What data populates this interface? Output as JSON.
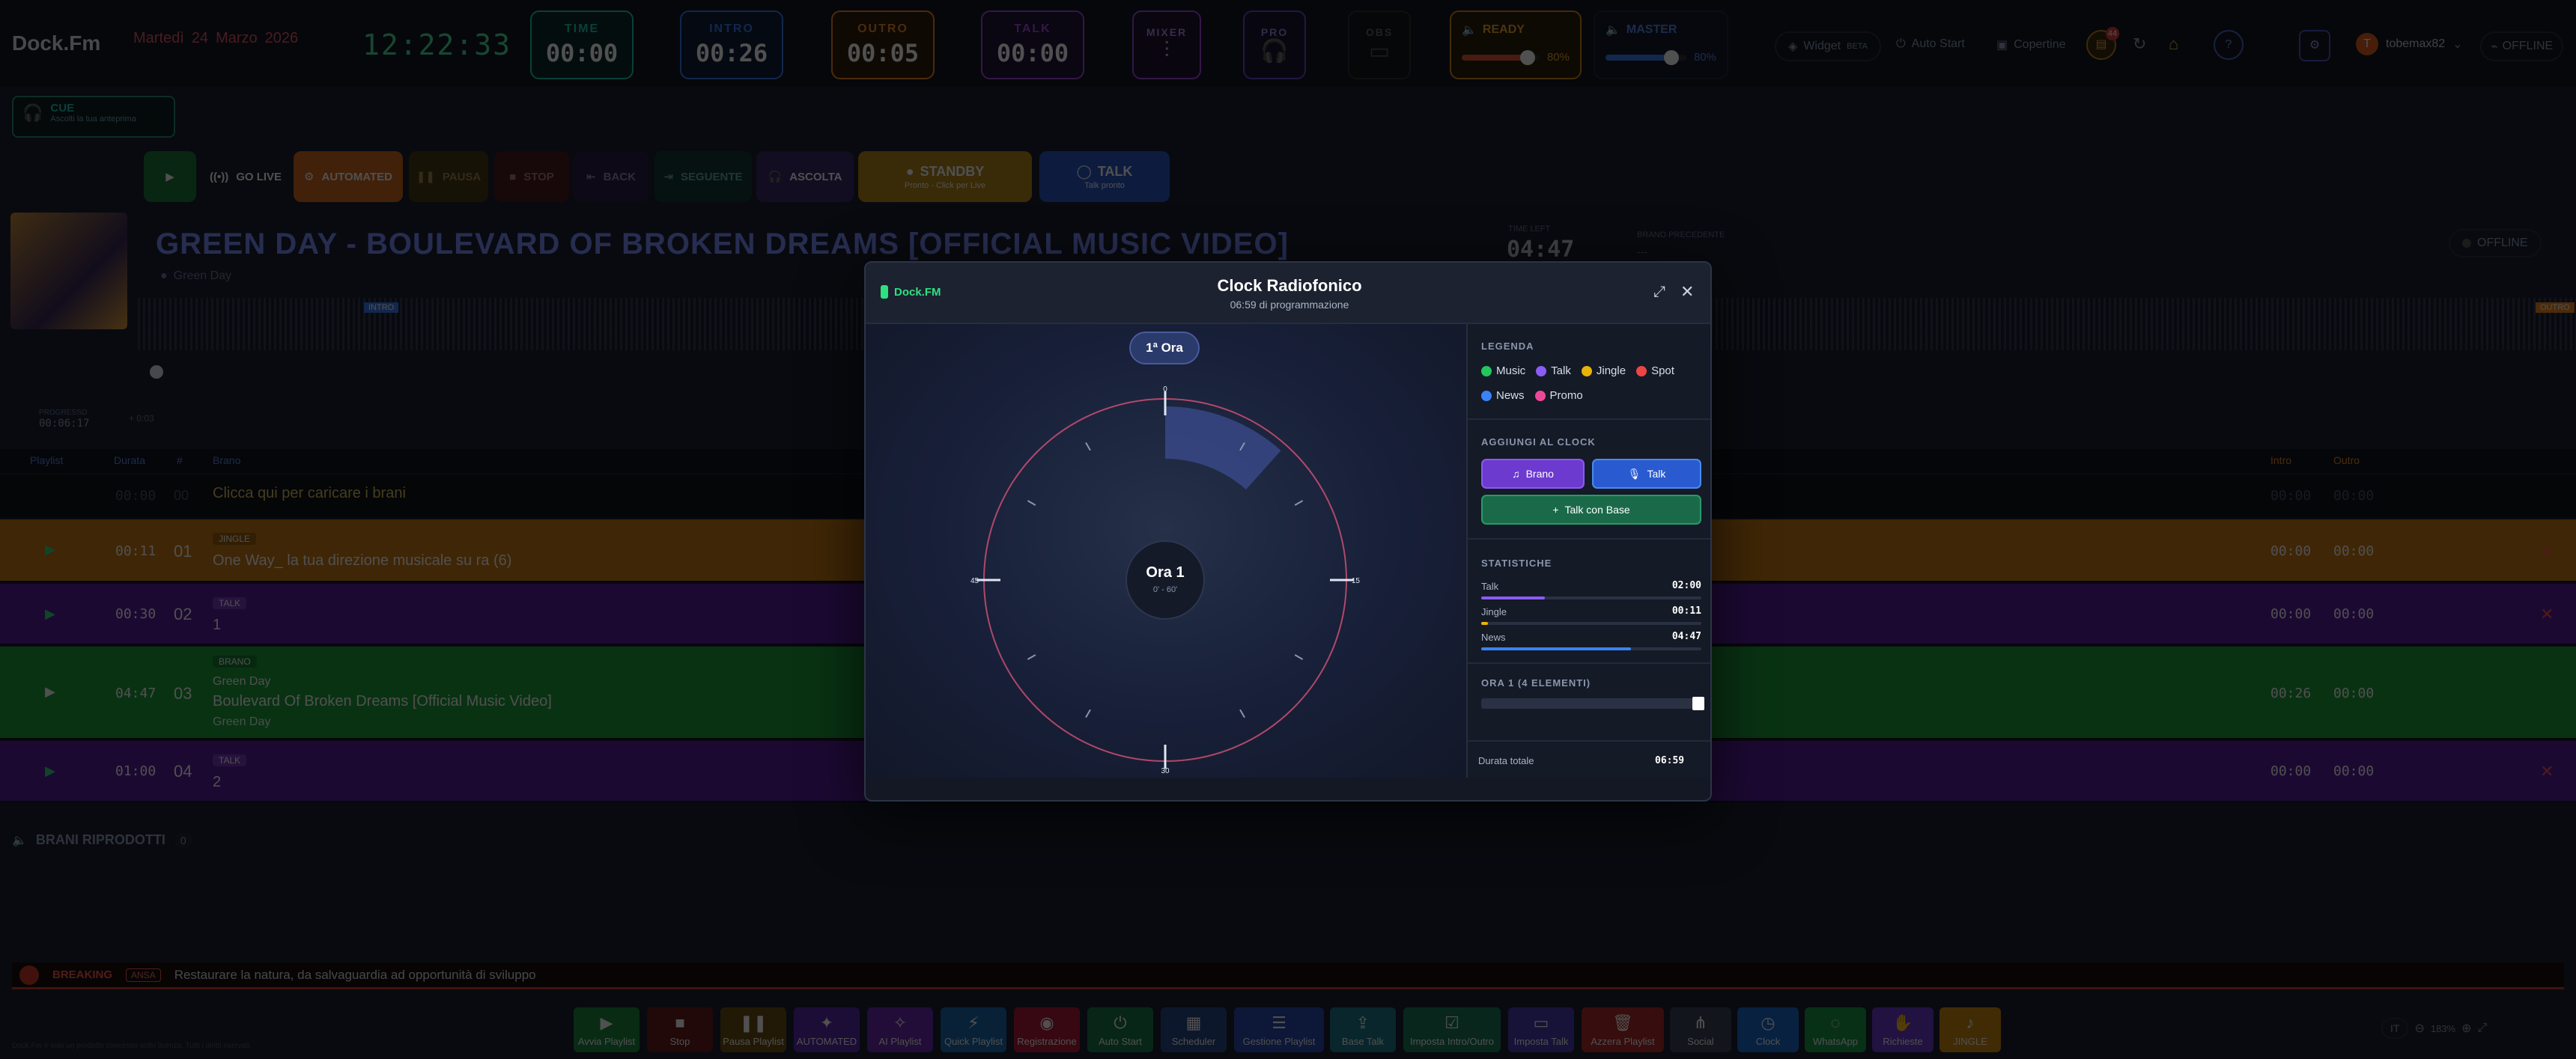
{
  "header": {
    "logo": "Dock.Fm",
    "weekday": "Martedì",
    "day": "24",
    "month": "Marzo",
    "year": "2026",
    "clock": "12:22:33",
    "counters": [
      {
        "label": "TIME",
        "value": "00:00",
        "color": "#21c7b4"
      },
      {
        "label": "INTRO",
        "value": "00:26",
        "color": "#3a7cf0"
      },
      {
        "label": "OUTRO",
        "value": "00:05",
        "color": "#f08a24"
      },
      {
        "label": "TALK",
        "value": "00:00",
        "color": "#a64ae8"
      }
    ],
    "mixer_label": "MIXER",
    "pro_label": "PRO",
    "obs_label": "OBS",
    "ready_label": "READY",
    "ready_volume": "80%",
    "master_label": "MASTER",
    "master_volume": "80%",
    "widget_label": "Widget",
    "widget_badge": "BETA",
    "autostart_label": "Auto Start",
    "copertine_label": "Copertine",
    "notif_badge": "44",
    "user_initial": "T",
    "username": "tobemax82",
    "status_label": "OFFLINE",
    "levels": {
      "ready": 0.8,
      "master": 0.8
    }
  },
  "cue": {
    "title": "CUE",
    "subtitle": "Ascolti la tua anteprima"
  },
  "transport": {
    "golive": "GO LIVE",
    "automated": "AUTOMATED",
    "pausa": "PAUSA",
    "stop": "STOP",
    "back": "BACK",
    "seguente": "SEGUENTE",
    "ascolta": "ASCOLTA",
    "standby": "STANDBY",
    "standby_sub": "Pronto - Click per Live",
    "talk": "TALK",
    "talk_sub": "Talk pronto"
  },
  "now_playing": {
    "title": "GREEN DAY - BOULEVARD OF BROKEN DREAMS [OFFICIAL MUSIC VIDEO]",
    "artist": "Green Day",
    "time_left_label": "TIME LEFT",
    "time_left": "04:47",
    "prev_label": "BRANO PRECEDENTE",
    "prev_value": "---",
    "intro_tag": "INTRO",
    "outro_tag": "OUTRO",
    "offline": "OFFLINE",
    "progress_label": "PROGRESSO",
    "progress_time": "00:06:17",
    "progress_extra": "+ 0:03"
  },
  "playlist": {
    "headers": {
      "playlist": "Playlist",
      "durata": "Durata",
      "num": "#",
      "brano": "Brano",
      "intro": "Intro",
      "outro": "Outro"
    },
    "load_hint": "Clicca qui per caricare i brani",
    "load_dur": "00:00",
    "load_num": "00",
    "load_intro": "00:00",
    "load_outro": "00:00",
    "rows": [
      {
        "dur": "00:11",
        "num": "01",
        "tag": "JINGLE",
        "title": "One Way_ la tua direzione musicale su ra (6)",
        "sub": "",
        "intro": "00:00",
        "outro": "00:00"
      },
      {
        "dur": "00:30",
        "num": "02",
        "tag": "TALK",
        "title": "1",
        "sub": "",
        "intro": "00:00",
        "outro": "00:00"
      },
      {
        "dur": "04:47",
        "num": "03",
        "tag": "BRANO",
        "title": "Boulevard Of Broken Dreams [Official Music Video]",
        "sub": "Green Day",
        "artist": "Green Day",
        "intro": "00:26",
        "outro": "00:00"
      },
      {
        "dur": "01:00",
        "num": "04",
        "tag": "TALK",
        "title": "2",
        "sub": "",
        "intro": "00:00",
        "outro": "00:00"
      }
    ]
  },
  "played": {
    "title": "BRANI RIPRODOTTI",
    "count": "0"
  },
  "breaking": {
    "label": "BREAKING",
    "source": "ANSA",
    "text": "Restaurare la natura, da salvaguardia ad opportunità di sviluppo"
  },
  "footer": {
    "buttons": [
      "Avvia Playlist",
      "Stop",
      "Pausa Playlist",
      "AUTOMATED",
      "AI Playlist",
      "Quick Playlist",
      "Registrazione",
      "Auto Start",
      "Scheduler",
      "Gestione Playlist",
      "Base Talk",
      "Imposta Intro/Outro",
      "Imposta Talk",
      "Azzera Playlist",
      "Social",
      "Clock",
      "WhatsApp",
      "Richieste",
      "JINGLE"
    ],
    "lang": "IT",
    "zoom": "183%",
    "copyright": "Dock.Fm è solo un prodotto concesso sotto licenza. Tutti i diritti riservati."
  },
  "modal": {
    "brand": "Dock.FM",
    "title": "Clock Radiofonico",
    "subtitle": "06:59 di programmazione",
    "hour_pill": "1ª Ora",
    "center_title": "Ora 1",
    "center_sub": "0' - 60'",
    "dial_labels": {
      "top": "0",
      "right": "15",
      "bottom": "30",
      "left": "45"
    },
    "legend_title": "LEGENDA",
    "legend": [
      {
        "name": "Music",
        "color": "#22c55e"
      },
      {
        "name": "Talk",
        "color": "#8b5cf6"
      },
      {
        "name": "Jingle",
        "color": "#eab308"
      },
      {
        "name": "Spot",
        "color": "#ef4444"
      },
      {
        "name": "News",
        "color": "#3b82f6"
      },
      {
        "name": "Promo",
        "color": "#ec4899"
      }
    ],
    "add_title": "AGGIUNGI AL CLOCK",
    "add_brano": "Brano",
    "add_talk": "Talk",
    "add_talk_base": "Talk con Base",
    "stats_title": "STATISTICHE",
    "stats": [
      {
        "name": "Talk",
        "value": "02:00",
        "color": "#8b5cf6",
        "fraction": 0.29
      },
      {
        "name": "Jingle",
        "value": "00:11",
        "color": "#eab308",
        "fraction": 0.03
      },
      {
        "name": "News",
        "value": "04:47",
        "color": "#3b82f6",
        "fraction": 0.68
      }
    ],
    "hour_title": "ORA 1 (4 ELEMENTI)",
    "total_label": "Durata totale",
    "total_value": "06:59",
    "segment_fraction": {
      "start": 0.0,
      "end": 0.116
    }
  }
}
